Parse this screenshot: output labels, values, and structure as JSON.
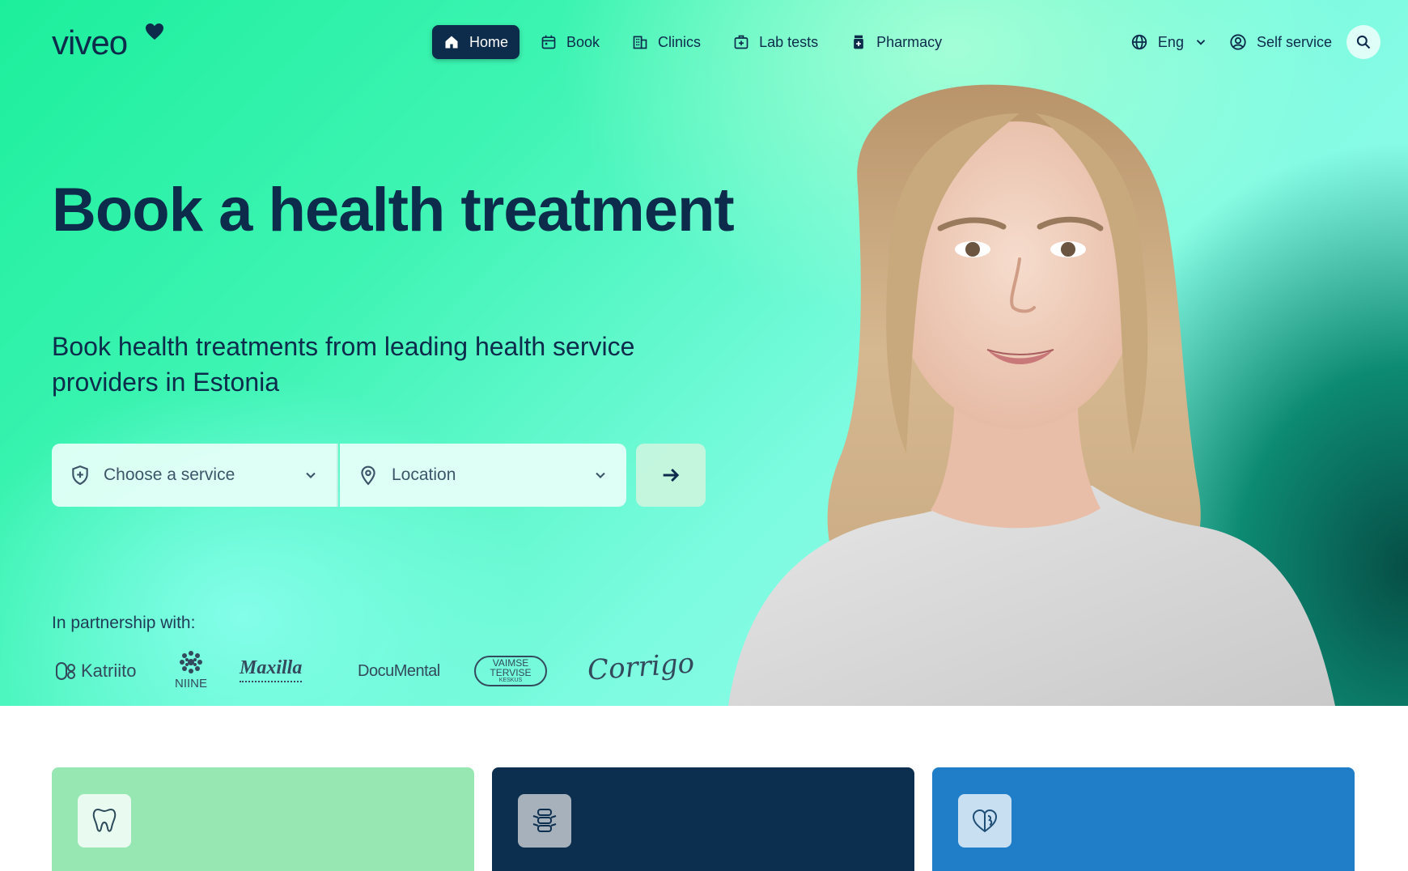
{
  "brand": {
    "logo_text": "viveo"
  },
  "nav": {
    "items": [
      {
        "label": "Home",
        "icon": "home-icon",
        "active": true
      },
      {
        "label": "Book",
        "icon": "calendar-icon",
        "active": false
      },
      {
        "label": "Clinics",
        "icon": "building-icon",
        "active": false
      },
      {
        "label": "Lab tests",
        "icon": "medical-kit-icon",
        "active": false
      },
      {
        "label": "Pharmacy",
        "icon": "medicine-bottle-icon",
        "active": false
      }
    ],
    "language": {
      "label": "Eng",
      "icon": "globe-icon"
    },
    "self_service": {
      "label": "Self service",
      "icon": "user-circle-icon"
    },
    "search_icon": "search-icon"
  },
  "hero": {
    "title": "Book a health treatment",
    "subtitle": "Book health treatments from leading health service providers in Estonia",
    "form": {
      "service_placeholder": "Choose a service",
      "location_placeholder": "Location",
      "submit_icon": "arrow-right-icon"
    },
    "partners_label": "In partnership with:",
    "partners": {
      "katriito": "Katriito",
      "niine": "NIINE",
      "maxilla": "Maxilla",
      "documental": "DocuMental",
      "vaimse_line1": "VAIMSE",
      "vaimse_line2": "TERVISE",
      "vaimse_line3": "KESKUS",
      "corrigo": "Corrigo"
    }
  },
  "cards": [
    {
      "icon": "tooth-icon"
    },
    {
      "icon": "spine-icon"
    },
    {
      "icon": "brain-heart-icon"
    }
  ],
  "colors": {
    "navy": "#0d2b4a",
    "mint": "#97e7b2",
    "dark_navy": "#0d2f4f",
    "blue": "#207ec8",
    "hero_green": "#1cef9c",
    "hero_aqua": "#8ffbe9"
  }
}
